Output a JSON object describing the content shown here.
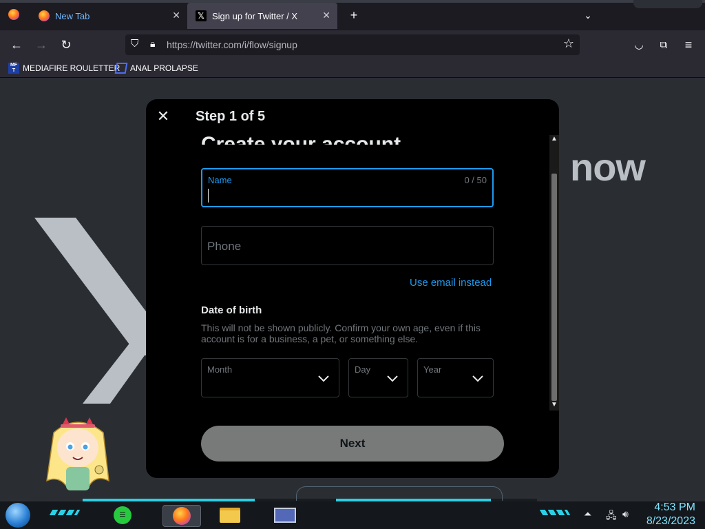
{
  "browser": {
    "tabs": [
      {
        "title": "New Tab",
        "active": false
      },
      {
        "title": "Sign up for Twitter / X",
        "active": true
      }
    ],
    "url": "https://twitter.com/i/flow/signup",
    "bookmarks": [
      "MEDIAFIRE ROULETTER",
      "ANAL PROLAPSE"
    ]
  },
  "background": {
    "partial_text": "now"
  },
  "modal": {
    "step": "Step 1 of 5",
    "heading": "Create your account",
    "name_field": {
      "label": "Name",
      "counter": "0 / 50",
      "value": ""
    },
    "phone_field": {
      "placeholder": "Phone"
    },
    "use_email_link": "Use email instead",
    "dob": {
      "title": "Date of birth",
      "description": "This will not be shown publicly. Confirm your own age, even if this account is for a business, a pet, or something else.",
      "month_label": "Month",
      "day_label": "Day",
      "year_label": "Year"
    },
    "next_button": "Next"
  },
  "taskbar": {
    "time": "4:53 PM",
    "date": "8/23/2023"
  },
  "colors": {
    "accent_blue": "#1d9bf0",
    "clock": "#7fe3ff"
  }
}
